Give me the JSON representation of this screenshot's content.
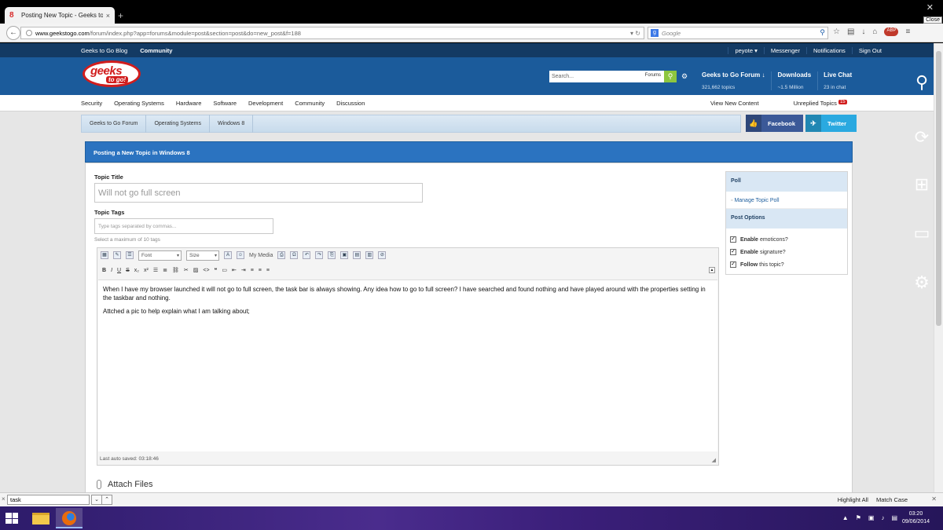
{
  "browser": {
    "tab_title": "Posting New Topic - Geeks to ...",
    "tab_close": "×",
    "new_tab": "+",
    "close_tooltip": "Close",
    "url_domain": "www.geekstogo.com",
    "url_path": "/forum/index.php?app=forums&module=post&section=post&do=new_post&f=188",
    "search_placeholder": "Google",
    "search_engine": "8",
    "abp_label": "ABP"
  },
  "topnav": {
    "blog": "Geeks to Go Blog",
    "community": "Community",
    "user": "peyote ▾",
    "messenger": "Messenger",
    "notifications": "Notifications",
    "signout": "Sign Out"
  },
  "header": {
    "logo_main": "geeks",
    "logo_sub": "to go!",
    "search_placeholder": "Search...",
    "search_scope": "Forums",
    "stats": [
      {
        "title": "Geeks to Go Forum ↓",
        "sub": "321,662 topics"
      },
      {
        "title": "Downloads",
        "sub": "~1.5 Million"
      },
      {
        "title": "Live Chat",
        "sub": "23 in chat"
      }
    ]
  },
  "catnav": {
    "items": [
      "Security",
      "Operating Systems",
      "Hardware",
      "Software",
      "Development",
      "Community",
      "Discussion"
    ],
    "view_new": "View New Content",
    "unreplied": "Unreplied Topics",
    "unreplied_count": "15"
  },
  "breadcrumbs": [
    "Geeks to Go Forum",
    "Operating Systems",
    "Windows 8"
  ],
  "social": {
    "facebook": "Facebook",
    "twitter": "Twitter"
  },
  "post": {
    "heading": "Posting a New Topic in Windows 8",
    "title_label": "Topic Title",
    "title_value": "Will not go full screen",
    "tags_label": "Topic Tags",
    "tags_placeholder": "Type tags separated by commas...",
    "tags_hint": "Select a maximum of 10 tags",
    "font_select": "Font",
    "size_select": "Size",
    "my_media": "My Media",
    "body_p1": "When I have my browser launched it will not go to full screen, the task bar is always showing. Any idea how to go to full screen? I have searched and found nothing and have played around with the properties setting in the taskbar and nothing.",
    "body_p2": "Attched a pic to help explain what I am talking about;",
    "autosave": "Last auto saved: 03:18:46",
    "attach": "Attach Files"
  },
  "sidebar": {
    "poll_header": "Poll",
    "manage_poll": "Manage Topic Poll",
    "options_header": "Post Options",
    "options": [
      {
        "bold": "Enable",
        "rest": "emoticons?"
      },
      {
        "bold": "Enable",
        "rest": "signature?"
      },
      {
        "bold": "Follow",
        "rest": "this topic?"
      }
    ]
  },
  "findbar": {
    "query": "task",
    "highlight": "Highlight All",
    "match_case": "Match Case"
  },
  "taskbar": {
    "time": "03:20",
    "date": "09/06/2014"
  }
}
